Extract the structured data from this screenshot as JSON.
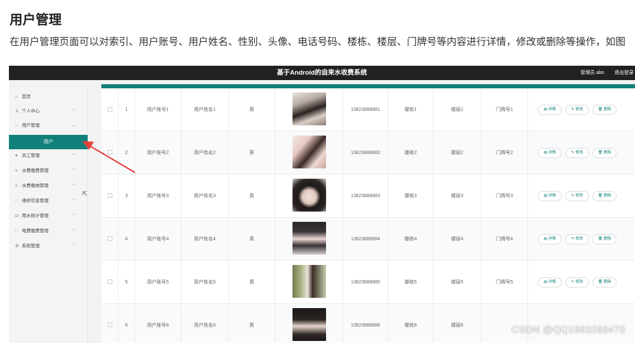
{
  "doc": {
    "heading": "用户管理",
    "paragraph": "在用户管理页面可以对索引、用户账号、用户姓名、性别、头像、电话号码、楼栋、楼层、门牌号等内容进行详情，修改或删除等操作，如图"
  },
  "app": {
    "title": "基于Android的自来水收费系统",
    "admin_label": "管理员 abo",
    "logout_label": "退出登录"
  },
  "sidebar": {
    "items": [
      {
        "label": "首页",
        "icon": "home-icon",
        "glyph": "⌂"
      },
      {
        "label": "个人中心",
        "icon": "person-icon",
        "glyph": "♙"
      },
      {
        "label": "用户管理",
        "icon": "grid-icon",
        "glyph": "∷"
      },
      {
        "label": "员工管理",
        "icon": "pin-icon",
        "glyph": "♥"
      },
      {
        "label": "水费缴费管理",
        "icon": "list-icon",
        "glyph": "≡"
      },
      {
        "label": "水费缴纳管理",
        "icon": "chart-icon",
        "glyph": "ıl"
      },
      {
        "label": "维修信息管理",
        "icon": "grid-icon",
        "glyph": "∷"
      },
      {
        "label": "用水统计管理",
        "icon": "table-icon",
        "glyph": "⊟"
      },
      {
        "label": "电费缴费管理",
        "icon": "grid-icon",
        "glyph": "∷"
      },
      {
        "label": "系统管理",
        "icon": "settings-icon",
        "glyph": "⚙"
      }
    ],
    "active_sub": "用户"
  },
  "rows": [
    {
      "index": "1",
      "account": "用户账号1",
      "name": "用户姓名1",
      "gender": "男",
      "phone": "13823888881",
      "building": "楼栋1",
      "floor": "楼层1",
      "door": "门牌号1"
    },
    {
      "index": "2",
      "account": "用户账号2",
      "name": "用户姓名2",
      "gender": "男",
      "phone": "13823888882",
      "building": "楼栋2",
      "floor": "楼层2",
      "door": "门牌号2"
    },
    {
      "index": "3",
      "account": "用户账号3",
      "name": "用户姓名3",
      "gender": "男",
      "phone": "13823888883",
      "building": "楼栋3",
      "floor": "楼层3",
      "door": "门牌号3"
    },
    {
      "index": "4",
      "account": "用户账号4",
      "name": "用户姓名4",
      "gender": "男",
      "phone": "13823888884",
      "building": "楼栋4",
      "floor": "楼层4",
      "door": "门牌号4"
    },
    {
      "index": "5",
      "account": "用户账号5",
      "name": "用户姓名5",
      "gender": "男",
      "phone": "13823888885",
      "building": "楼栋5",
      "floor": "楼层5",
      "door": "门牌号5"
    },
    {
      "index": "6",
      "account": "用户账号6",
      "name": "用户姓名6",
      "gender": "男",
      "phone": "13823888886",
      "building": "楼栋6",
      "floor": "楼层6",
      "door": ""
    }
  ],
  "actions": {
    "detail": "详情",
    "edit": "修改",
    "delete": "删除"
  },
  "watermark": "CSDN @QQ1963288475",
  "colors": {
    "accent": "#11807b",
    "topbar": "#212121",
    "arrow": "#e8413b"
  }
}
